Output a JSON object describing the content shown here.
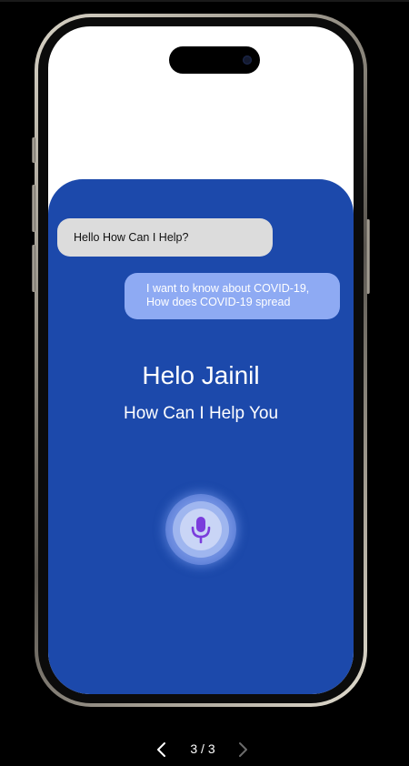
{
  "chat": {
    "bot_message": "Hello How Can I Help?",
    "user_message": "I want to know about COVID-19,\nHow does COVID-19 spread"
  },
  "main": {
    "greeting": "Helo Jainil",
    "subtitle": "How Can I Help You"
  },
  "mic": {
    "icon": "microphone-icon",
    "icon_color": "#7a3cdc"
  },
  "pager": {
    "counter": "3 / 3",
    "prev_icon": "chevron-left-icon",
    "next_icon": "chevron-right-icon"
  },
  "colors": {
    "background": "#000000",
    "panel": "#1c49ab",
    "bot_bubble": "#dcdcdc",
    "user_bubble": "#8eaaf3"
  }
}
